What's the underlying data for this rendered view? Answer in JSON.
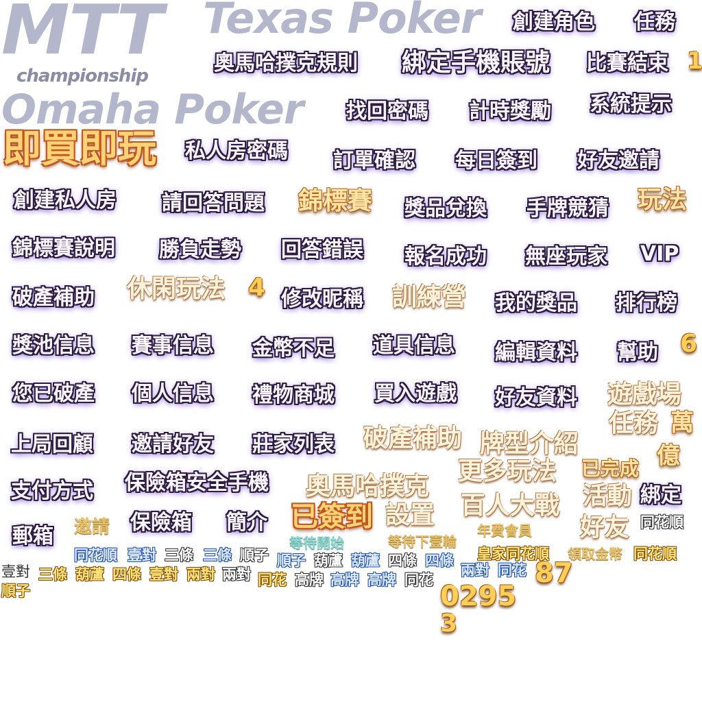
{
  "atlas": {
    "logos": {
      "mtt": "MTT",
      "texas_poker": "Texas Poker",
      "championship": "championship",
      "omaha_poker": "Omaha Poker"
    },
    "labels": {
      "create_character": "創建角色",
      "tasks": "任務",
      "omaha_rules": "奧馬哈撲克規則",
      "bind_phone": "綁定手機賬號",
      "match_over": "比賽結束",
      "find_password": "找回密碼",
      "timed_reward": "計時獎勵",
      "system_notice": "系統提示",
      "private_room_password": "私人房密碼",
      "order_confirm": "訂單確認",
      "daily_checkin": "每日簽到",
      "friend_invite": "好友邀請",
      "create_private_room": "創建私人房",
      "answer_question": "請回答問題",
      "prize_exchange": "獎品兌換",
      "hand_guess": "手牌競猜",
      "tournament_rules": "錦標賽說明",
      "win_trend": "勝負走勢",
      "answer_wrong": "回答錯誤",
      "signup_success": "報名成功",
      "no_seat_players": "無座玩家",
      "vip": "VIP",
      "bankrupt_aid": "破產補助",
      "change_nickname": "修改昵稱",
      "my_prizes": "我的獎品",
      "leaderboard": "排行榜",
      "jackpot_info": "獎池信息",
      "event_info": "賽事信息",
      "coins_insufficient": "金幣不足",
      "item_info": "道具信息",
      "edit_profile": "編輯資料",
      "help": "幫助",
      "you_are_bankrupt": "您已破產",
      "personal_info": "個人信息",
      "gift_mall": "禮物商城",
      "buy_in_game": "買入遊戲",
      "friend_profile": "好友資料",
      "last_hand_review": "上局回顧",
      "invite_friends": "邀請好友",
      "dealer_list": "莊家列表",
      "payment_method": "支付方式",
      "safe_phone": "保險箱安全手機",
      "mailbox": "郵箱",
      "safe_box": "保險箱",
      "intro": "簡介"
    },
    "gold_labels": {
      "buy_and_play": "即買即玩",
      "tournament": "錦標賽",
      "gameplay": "玩法",
      "casual_play": "休閑玩法",
      "training_camp": "訓練營",
      "game_lobby": "遊戲場",
      "task_gold": "任務",
      "ten_thousand": "萬",
      "hundred_million": "億",
      "bankrupt_aid_gold": "破產補助",
      "hand_types_intro": "牌型介紹",
      "more_gameplay": "更多玩法",
      "completed": "已完成",
      "omaha_poker_cn": "奧馬哈撲克",
      "hundred_battle": "百人大戰",
      "event_activity": "活動",
      "bind": "綁定",
      "friends": "好友",
      "checked_in": "已簽到",
      "settings": "設置",
      "straight_flush_grey": "同花順"
    },
    "numbers": {
      "n1": "1",
      "n4": "4",
      "n6": "6",
      "n87": "87",
      "n0295": "0295",
      "n3": "3"
    },
    "small_texts": {
      "invite": "邀請",
      "waiting_start": "等待開始",
      "waiting_next_round": "等待下壹輪",
      "annual_member": "年費會員",
      "royal_flush": "皇家同花順",
      "claim_coins": "領取金幣",
      "straight_flush_gold": "同花順"
    },
    "hand_rows": {
      "row1": [
        "同花順",
        "壹對",
        "三條",
        "三條",
        "順子"
      ],
      "row2": [
        "順子",
        "葫蘆",
        "葫蘆",
        "四條",
        "四條"
      ],
      "row3": [
        "兩對",
        "同花"
      ],
      "row4": [
        "壹對",
        "三條",
        "葫蘆",
        "四條",
        "壹對",
        "兩對",
        "兩對",
        "同花",
        "高牌",
        "高牌",
        "高牌",
        "同花"
      ],
      "row5": [
        "順子"
      ]
    },
    "colors": {
      "label_fill": "#fbf5ff",
      "label_outline": "#2a1d3f",
      "label_glow": "#8e6fd8",
      "gold_fill": "#ffe4a8",
      "gold_outline": "#b8651c",
      "logo_grey": "#b4b6cc",
      "hand_blue": "#1f4ea8",
      "hand_gold": "#ffe37a"
    }
  }
}
